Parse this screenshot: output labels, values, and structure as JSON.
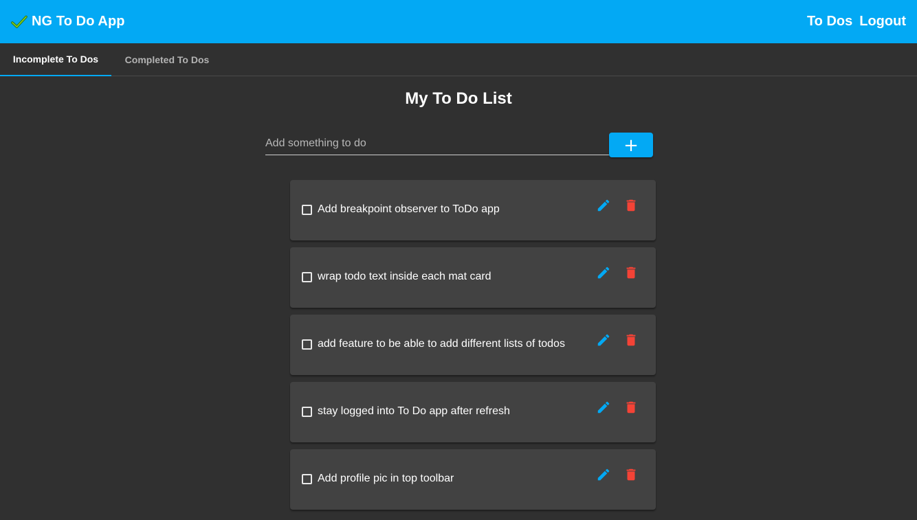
{
  "colors": {
    "primary": "#03a9f4",
    "background": "#303030",
    "card": "#424242",
    "check_icon": "#4caf50",
    "delete": "#f44336"
  },
  "toolbar": {
    "brand_icon": "check-icon",
    "title": "NG To Do App",
    "nav_todos": "To Dos",
    "nav_logout": "Logout"
  },
  "tabs": [
    {
      "label": "Incomplete To Dos",
      "active": true
    },
    {
      "label": "Completed To Dos",
      "active": false
    }
  ],
  "main": {
    "title": "My To Do List",
    "add_placeholder": "Add something to do",
    "add_button": "+"
  },
  "todos": [
    {
      "text": "Add breakpoint observer to ToDo app",
      "done": false
    },
    {
      "text": "wrap todo text inside each mat card",
      "done": false
    },
    {
      "text": "add feature to be able to add different lists of todos",
      "done": false
    },
    {
      "text": "stay logged into To Do app after refresh",
      "done": false
    },
    {
      "text": "Add profile pic in top toolbar",
      "done": false
    }
  ],
  "icons": {
    "edit": "pencil-icon",
    "delete": "trash-icon"
  }
}
